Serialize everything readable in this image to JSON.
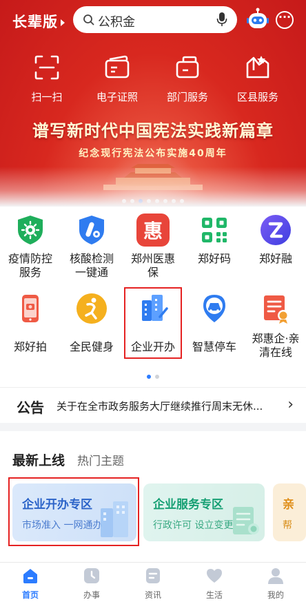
{
  "header": {
    "elder_mode": "长辈版",
    "search_placeholder": "公积金"
  },
  "quick_actions": [
    {
      "label": "扫一扫",
      "icon": "scan-icon"
    },
    {
      "label": "电子证照",
      "icon": "card-icon"
    },
    {
      "label": "部门服务",
      "icon": "briefcase-icon"
    },
    {
      "label": "区县服务",
      "icon": "map-icon"
    }
  ],
  "banner": {
    "headline": "谱写新时代中国宪法实践新篇章",
    "subline": "纪念现行宪法公布实施40周年",
    "page_count": 8,
    "active_index": 2
  },
  "services": [
    {
      "label": "疫情防控服务",
      "icon": "virus-shield-icon",
      "color": "#1fae5b"
    },
    {
      "label": "核酸检测一键通",
      "icon": "test-tube-shield-icon",
      "color": "#2f7cf0"
    },
    {
      "label": "郑州医惠保",
      "icon": "hui-icon",
      "color": "#e8453a"
    },
    {
      "label": "郑好码",
      "icon": "qr-code-icon",
      "color": "#20b768"
    },
    {
      "label": "郑好融",
      "icon": "z-finance-icon",
      "color": "#5a4cf0"
    },
    {
      "label": "郑好拍",
      "icon": "camera-phone-icon",
      "color": "#ef5a45"
    },
    {
      "label": "全民健身",
      "icon": "fitness-icon",
      "color": "#f5b01e"
    },
    {
      "label": "企业开办",
      "icon": "building-icon",
      "color": "#2f7cf0"
    },
    {
      "label": "智慧停车",
      "icon": "parking-car-icon",
      "color": "#2f7cf0"
    },
    {
      "label": "郑惠企·亲清在线",
      "icon": "certificate-icon",
      "color": "#ef5a45"
    }
  ],
  "notice": {
    "tag": "公告",
    "text": "关于在全市政务服务大厅继续推行周末无休..."
  },
  "latest": {
    "tabs": [
      "最新上线",
      "热门主题"
    ],
    "cards": [
      {
        "title": "企业开办专区",
        "subtitle": "市场准入 一网通办",
        "accent": "#2b63c8"
      },
      {
        "title": "企业服务专区",
        "subtitle": "行政许可 设立变更",
        "accent": "#17a074"
      },
      {
        "title": "亲",
        "subtitle": "帮",
        "accent": "#e0901c"
      }
    ]
  },
  "bottom_nav": [
    {
      "label": "首页",
      "icon": "home-icon",
      "active": true
    },
    {
      "label": "办事",
      "icon": "clock-icon",
      "active": false
    },
    {
      "label": "资讯",
      "icon": "news-icon",
      "active": false
    },
    {
      "label": "生活",
      "icon": "heart-icon",
      "active": false
    },
    {
      "label": "我的",
      "icon": "user-icon",
      "active": false
    }
  ],
  "colors": {
    "brand_red": "#d8281f",
    "accent_blue": "#2c7cff",
    "highlight_red": "#e52222"
  }
}
